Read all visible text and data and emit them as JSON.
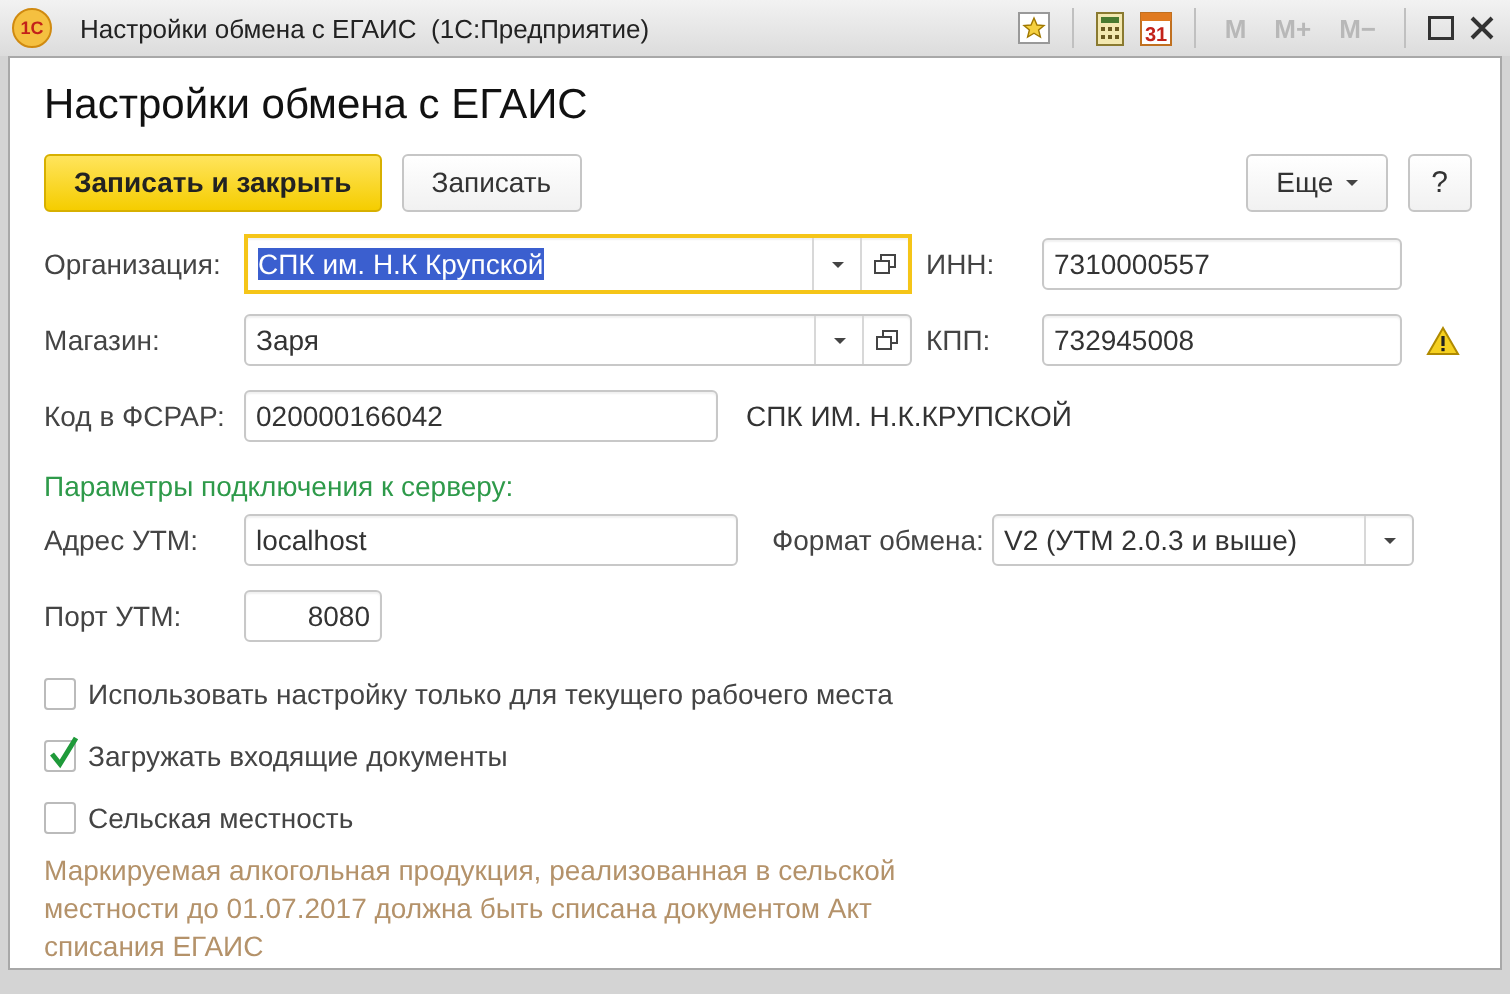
{
  "window": {
    "logo": "1С",
    "title": "Настройки обмена с ЕГАИС  (1С:Предприятие)",
    "calendar_day": "31",
    "memory_buttons": [
      {
        "label": "M",
        "disabled": true
      },
      {
        "label": "M+",
        "disabled": true
      },
      {
        "label": "M−",
        "disabled": true
      }
    ]
  },
  "heading": "Настройки обмена с ЕГАИС",
  "buttons": [
    {
      "label": "Записать и закрыть",
      "kind": "primary"
    },
    {
      "label": "Записать",
      "kind": "normal"
    },
    {
      "label": "Еще",
      "kind": "menu"
    },
    {
      "label": "?",
      "kind": "help"
    }
  ],
  "organization": {
    "label": "Организация:",
    "value": "СПК им. Н.К Крупской",
    "focused": true
  },
  "inn": {
    "label": "ИНН:",
    "value": "7310000557"
  },
  "store": {
    "label": "Магазин:",
    "value": "Заря",
    "focused": false
  },
  "kpp": {
    "label": "КПП:",
    "value": "732945008",
    "warning": true
  },
  "fsrar": {
    "label": "Код в ФСРАР:",
    "value": "020000166042",
    "org_name": "СПК ИМ. Н.К.КРУПСКОЙ"
  },
  "server_section": "Параметры подключения к серверу:",
  "utm_address": {
    "label": "Адрес УТМ:",
    "value": "localhost"
  },
  "exchange_format": {
    "label": "Формат обмена:",
    "value": "V2 (УТМ 2.0.3 и выше)"
  },
  "utm_port": {
    "label": "Порт УТМ:",
    "value": "8080"
  },
  "checkboxes": [
    {
      "label": "Использовать настройку только для текущего рабочего места",
      "checked": false
    },
    {
      "label": "Загружать входящие документы",
      "checked": true
    },
    {
      "label": "Сельская местность",
      "checked": false
    }
  ],
  "note": "Маркируемая алкогольная продукция, реализованная в сельской местности до 01.07.2017 должна быть списана документом Акт списания ЕГАИС"
}
